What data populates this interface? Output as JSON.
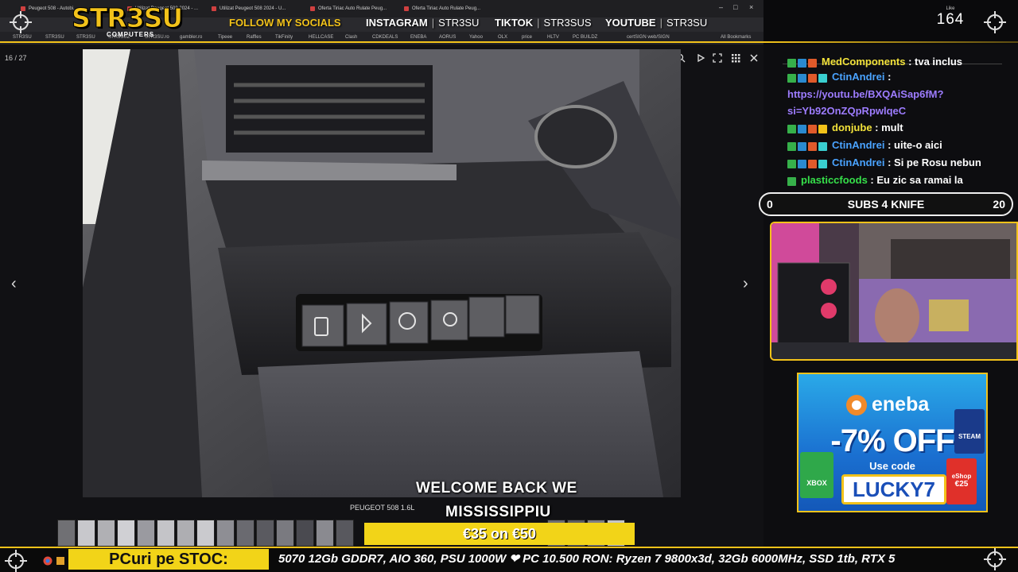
{
  "browser": {
    "tabs": [
      "Peugeot 508 - Autobi...",
      "Utilizat Peugeot 508 2024 - ...",
      "Utilizat Peugeot 508 2024 - U...",
      "Oferta Tiriac Auto Rulate Peug...",
      "Oferta Tiriac Auto Rulate Peug..."
    ],
    "bookmarks": [
      "STR3SU",
      "STR3SU",
      "STR3SU",
      "STR3SUZ",
      "STR3SU.ro",
      "gambler.ro",
      "Tipeee",
      "Raffles",
      "TikFinity",
      "HELLCASE",
      "Clash",
      "CDKDEALS",
      "ENEBA",
      "AORUS",
      "Yahoo",
      "OLX",
      "price",
      "HLTV",
      "PC BUILDZ",
      "certSIGN web/SIGN",
      "All Bookmarks"
    ]
  },
  "overlay": {
    "logo": "STR3SU",
    "logo_sub": "COMPUTERS",
    "follow": "FOLLOW MY SOCIALS",
    "instagram_label": "INSTAGRAM",
    "instagram_handle": "STR3SU",
    "tiktok_label": "TIKTOK",
    "tiktok_handle": "STR3SUS",
    "youtube_label": "YOUTUBE",
    "youtube_handle": "STR3SU",
    "like_label": "Like",
    "like_count": "164"
  },
  "viewer": {
    "counter": "16 / 27",
    "caption": "PEUGEOT 508 1.6L",
    "prev": "‹",
    "next": "›",
    "tools": [
      "zoom-icon",
      "play-icon",
      "fullscreen-icon",
      "grid-icon",
      "close-icon"
    ]
  },
  "subtitles": {
    "line1": "WELCOME BACK WE",
    "line2": "MISSISSIPPIU"
  },
  "coupon": "€35 on €50",
  "chat": [
    {
      "user": "MedComponents",
      "text": ": tva inclus",
      "color": "yellow",
      "partial": true
    },
    {
      "user": "CtinAndrei",
      "text": ":",
      "color": "blue",
      "link": "https://youtu.be/BXQAiSap6fM?si=Yb92OnZQpRpwlqeC"
    },
    {
      "user": "donjube",
      "text": ": mult",
      "color": "yellow"
    },
    {
      "user": "CtinAndrei",
      "text": ": uite-o aici",
      "color": "blue"
    },
    {
      "user": "CtinAndrei",
      "text": ": Si pe Rosu nebun",
      "color": "blue"
    },
    {
      "user": "plasticcfoods",
      "text": ": Eu zic sa ramai la",
      "color": "green"
    }
  ],
  "chat_link_line1": "https://youtu.be/BXQAiSap6fM?",
  "chat_link_line2": "si=Yb92OnZQpRpwlqeC",
  "goal": {
    "left": "0",
    "title": "SUBS 4 KNIFE",
    "right": "20"
  },
  "ad": {
    "brand": "eneba",
    "discount": "-7% OFF",
    "use_code": "Use code",
    "code": "LUCKY7",
    "steam": "STEAM",
    "xbox": "XBOX",
    "eshop": "eShop",
    "price": "€25"
  },
  "ticker": {
    "label": "PCuri pe STOC:",
    "text": "5070 12Gb GDDR7, AIO 360, PSU 1000W   ❤ PC 10.500 RON: Ryzen 7 9800x3d, 32Gb 6000MHz, SSD 1tb, RTX 5"
  },
  "colors": {
    "accent": "#f2c21a",
    "chat_blue": "#4aa3ff",
    "chat_yellow": "#f2e23a",
    "chat_green": "#36e04a",
    "link": "#9d7cff"
  }
}
